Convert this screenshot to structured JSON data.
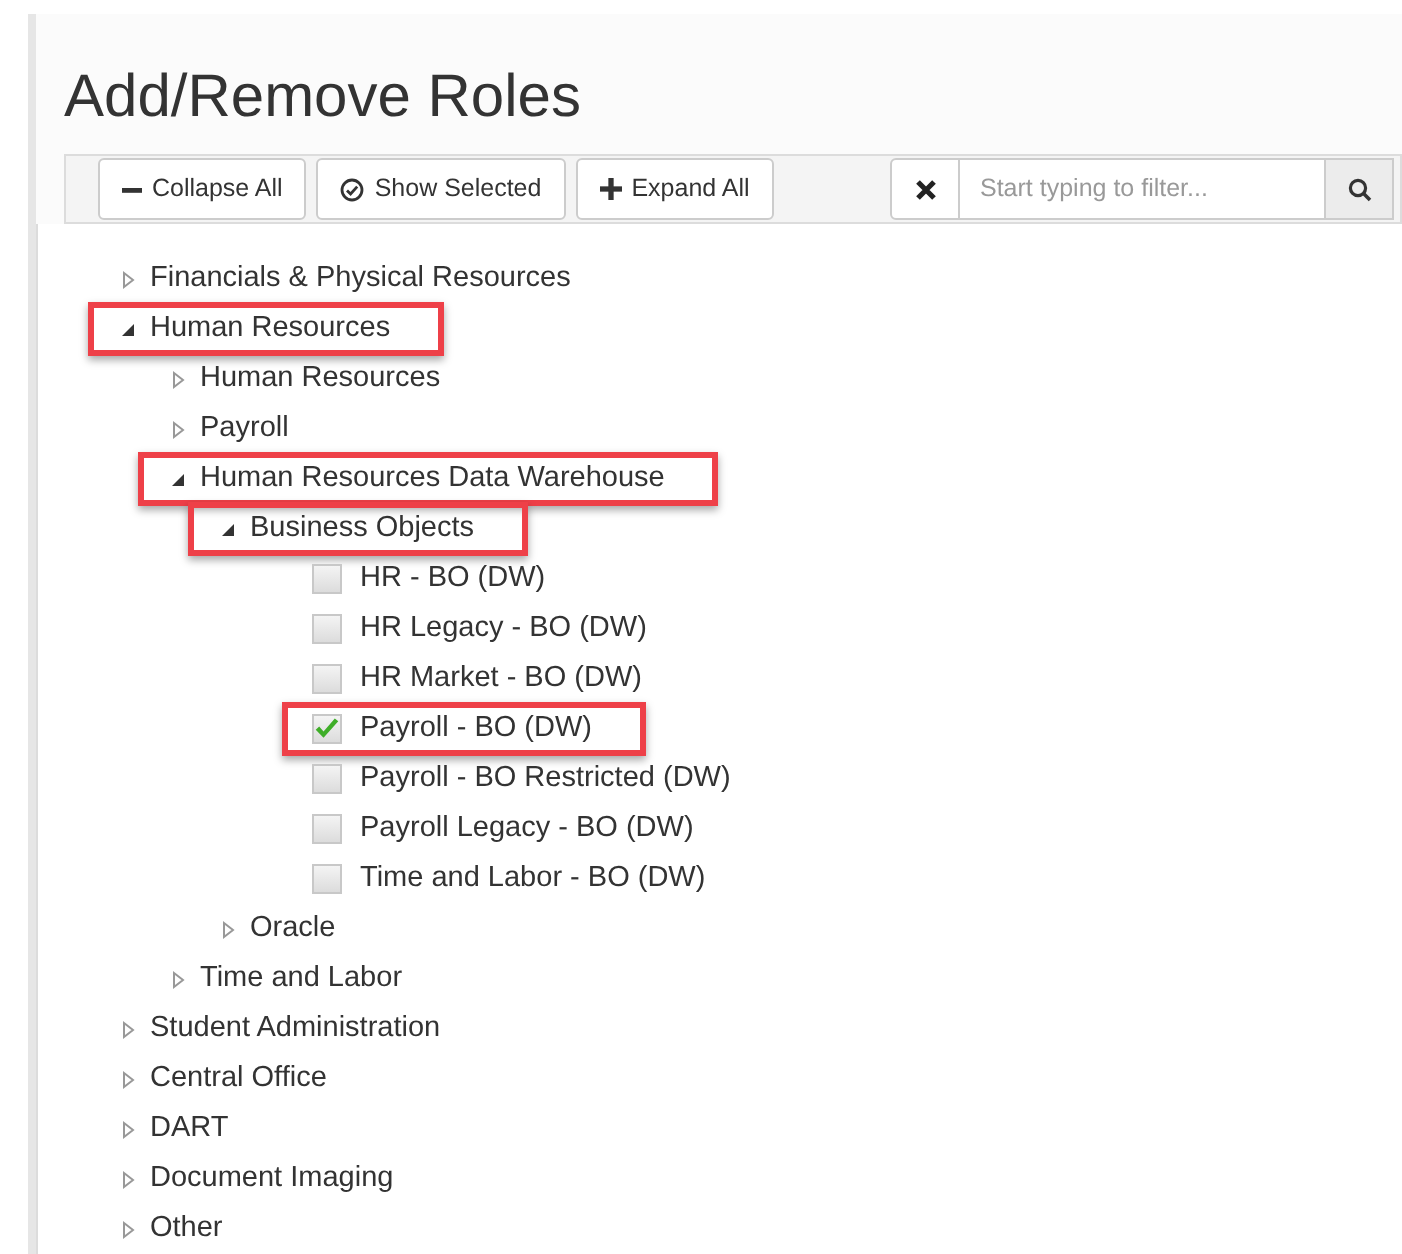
{
  "title": "Add/Remove Roles",
  "toolbar": {
    "buttons": [
      {
        "kind": "collapse",
        "label": "Collapse All"
      },
      {
        "kind": "show",
        "label": "Show Selected"
      },
      {
        "kind": "expand",
        "label": "Expand All"
      }
    ],
    "filter": {
      "placeholder": "Start typing to filter..."
    }
  },
  "tree": [
    {
      "kind": "branch",
      "label": "Financials & Physical Resources",
      "expanded": false,
      "highlighted": false
    },
    {
      "kind": "branch",
      "label": "Human Resources",
      "expanded": true,
      "highlighted": true,
      "children": [
        {
          "kind": "branch",
          "label": "Human Resources",
          "expanded": false,
          "highlighted": false
        },
        {
          "kind": "branch",
          "label": "Payroll",
          "expanded": false,
          "highlighted": false
        },
        {
          "kind": "branch",
          "label": "Human Resources Data Warehouse",
          "expanded": true,
          "highlighted": true,
          "children": [
            {
              "kind": "branch",
              "label": "Business Objects",
              "expanded": true,
              "highlighted": true,
              "children": [
                {
                  "kind": "leaf",
                  "label": "HR - BO (DW)",
                  "checked": false,
                  "highlighted": false
                },
                {
                  "kind": "leaf",
                  "label": "HR Legacy - BO (DW)",
                  "checked": false,
                  "highlighted": false
                },
                {
                  "kind": "leaf",
                  "label": "HR Market - BO (DW)",
                  "checked": false,
                  "highlighted": false
                },
                {
                  "kind": "leaf",
                  "label": "Payroll - BO (DW)",
                  "checked": true,
                  "highlighted": true
                },
                {
                  "kind": "leaf",
                  "label": "Payroll - BO Restricted (DW)",
                  "checked": false,
                  "highlighted": false
                },
                {
                  "kind": "leaf",
                  "label": "Payroll Legacy - BO (DW)",
                  "checked": false,
                  "highlighted": false
                },
                {
                  "kind": "leaf",
                  "label": "Time and Labor - BO (DW)",
                  "checked": false,
                  "highlighted": false
                }
              ]
            },
            {
              "kind": "branch",
              "label": "Oracle",
              "expanded": false,
              "highlighted": false
            }
          ]
        },
        {
          "kind": "branch",
          "label": "Time and Labor",
          "expanded": false,
          "highlighted": false
        }
      ]
    },
    {
      "kind": "branch",
      "label": "Student Administration",
      "expanded": false,
      "highlighted": false
    },
    {
      "kind": "branch",
      "label": "Central Office",
      "expanded": false,
      "highlighted": false
    },
    {
      "kind": "branch",
      "label": "DART",
      "expanded": false,
      "highlighted": false
    },
    {
      "kind": "branch",
      "label": "Document Imaging",
      "expanded": false,
      "highlighted": false
    },
    {
      "kind": "branch",
      "label": "Other",
      "expanded": false,
      "highlighted": false
    }
  ]
}
